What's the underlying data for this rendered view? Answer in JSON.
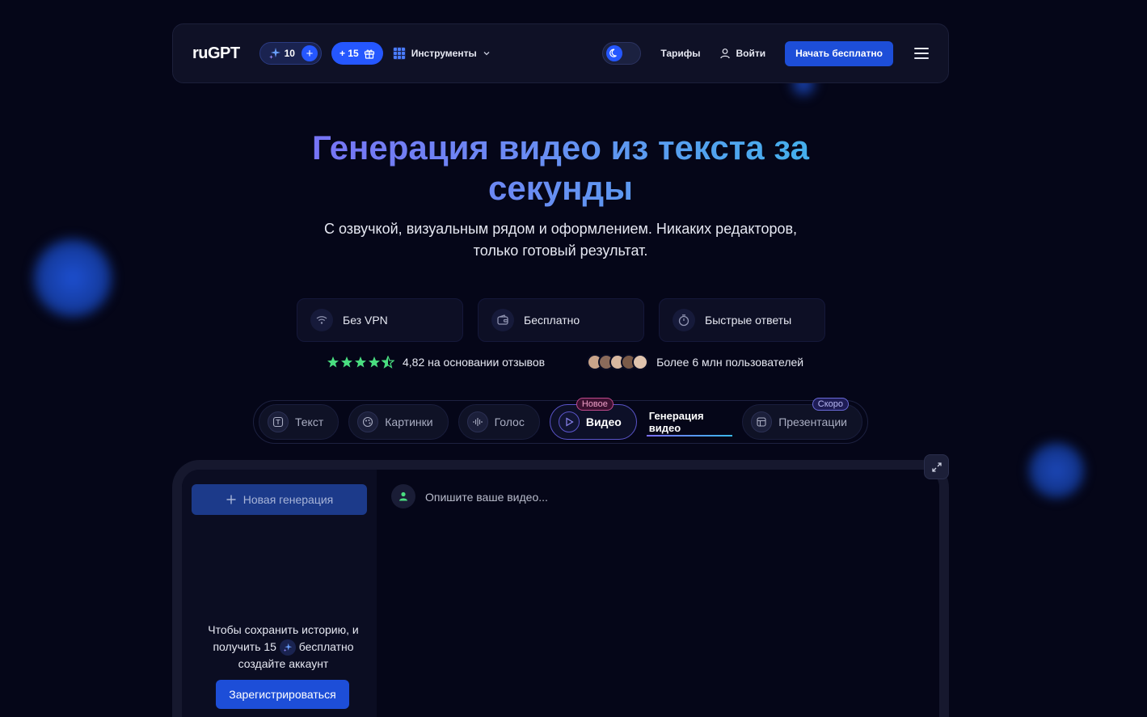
{
  "header": {
    "logo": "ruGPT",
    "credits": "10",
    "bonus": "+ 15",
    "tools_label": "Инструменты",
    "tariffs": "Тарифы",
    "login": "Войти",
    "cta": "Начать бесплатно"
  },
  "hero": {
    "title": "Генерация видео из текста за секунды",
    "subtitle_line1": "С озвучкой, визуальным рядом и оформлением. Никаких редакторов,",
    "subtitle_line2": "только готовый результат."
  },
  "features": [
    {
      "label": "Без VPN",
      "icon": "wifi-icon"
    },
    {
      "label": "Бесплатно",
      "icon": "wallet-icon"
    },
    {
      "label": "Быстрые ответы",
      "icon": "timer-icon"
    }
  ],
  "proof": {
    "rating_text": "4,82 на основании отзывов",
    "rating": 4.82,
    "users_text": "Более 6 млн пользователей"
  },
  "tabs": {
    "text": "Текст",
    "images": "Картинки",
    "voice": "Голос",
    "video": "Видео",
    "video_badge": "Новое",
    "video_generation": "Генерация видео",
    "presentations": "Презентации",
    "presentations_badge": "Скоро"
  },
  "app": {
    "new_generation": "Новая генерация",
    "hint_line1": "Чтобы сохранить историю, и",
    "hint_line2a": "получить 15",
    "hint_line2b": "бесплатно",
    "hint_line3": "создайте аккаунт",
    "register": "Зарегистрироваться",
    "prompt_placeholder": "Опишите ваше видео..."
  },
  "colors": {
    "background": "#050618",
    "accent": "#1d4ed8",
    "star": "#4ade80"
  }
}
